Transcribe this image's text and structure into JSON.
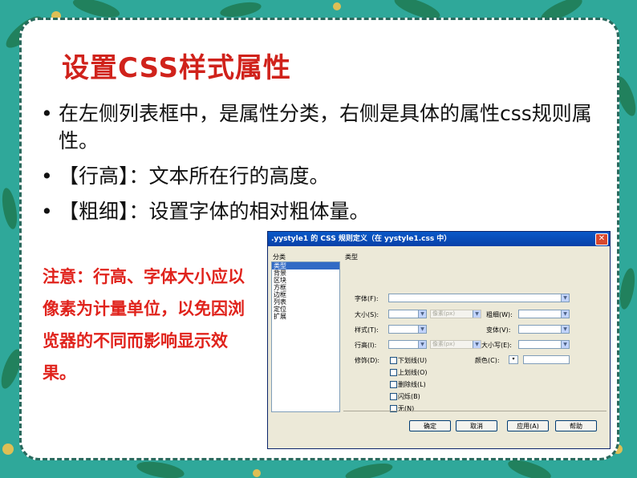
{
  "slide": {
    "title": "设置CSS样式属性",
    "bullets": [
      "在左侧列表框中，是属性分类，右侧是具体的属性css规则属性。",
      "【行高】：文本所在行的高度。",
      "【粗细】：设置字体的相对粗体量。"
    ],
    "note": "注意：行高、字体大小应以像素为计量单位，以免因浏览器的不同而影响显示效果。",
    "colors": {
      "title": "#d0221b",
      "note": "#e0231c",
      "background": "#2fa89a"
    }
  },
  "dialog": {
    "title": ".yystyle1 的 CSS 规则定义（在 yystyle1.css 中）",
    "close": "✕",
    "category_header": "分类",
    "type_header": "类型",
    "categories": [
      "类型",
      "背景",
      "区块",
      "方框",
      "边框",
      "列表",
      "定位",
      "扩展"
    ],
    "fields": {
      "font": "字体(F):",
      "size": "大小(S):",
      "weight": "粗细(W):",
      "style": "样式(T):",
      "variant": "变体(V):",
      "line_height": "行高(I):",
      "case": "大小写(E):",
      "decoration": "修饰(D):",
      "color": "颜色(C):"
    },
    "unit_placeholder": "像素(px)",
    "decorations": [
      "下划线(U)",
      "上划线(O)",
      "删除线(L)",
      "闪烁(B)",
      "无(N)"
    ],
    "buttons": [
      "确定",
      "取消",
      "应用(A)",
      "帮助"
    ]
  }
}
